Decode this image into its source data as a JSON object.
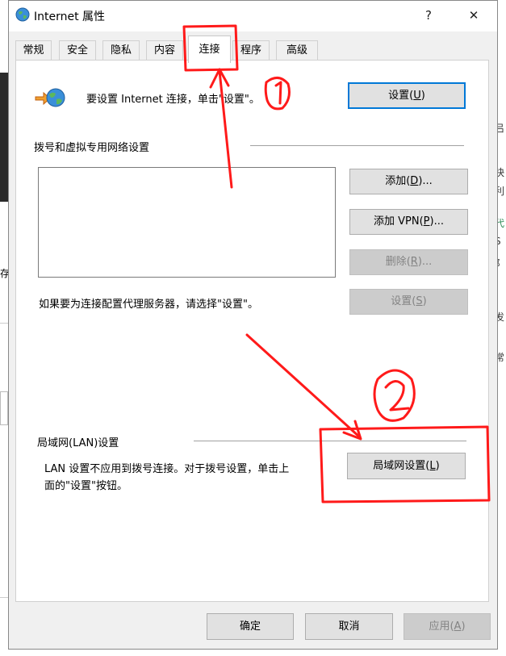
{
  "window": {
    "title": "Internet 属性",
    "help_glyph": "?",
    "close_glyph": "✕"
  },
  "tabs": [
    {
      "label": "常规"
    },
    {
      "label": "安全"
    },
    {
      "label": "隐私"
    },
    {
      "label": "内容"
    },
    {
      "label": "连接",
      "active": true
    },
    {
      "label": "程序"
    },
    {
      "label": "高级"
    }
  ],
  "setup": {
    "text": "要设置 Internet 连接，单击\"设置\"。",
    "button": {
      "pre": "设置(",
      "key": "U",
      "post": ")"
    }
  },
  "dialup": {
    "heading": "拨号和虚拟专用网络设置",
    "add": {
      "pre": "添加(",
      "key": "D",
      "post": ")..."
    },
    "add_vpn": {
      "pre": "添加 VPN(",
      "key": "P",
      "post": ")..."
    },
    "remove": {
      "pre": "删除(",
      "key": "R",
      "post": ")..."
    },
    "settings": {
      "pre": "设置(",
      "key": "S",
      "post": ")"
    },
    "proxy_note": "如果要为连接配置代理服务器，请选择\"设置\"。"
  },
  "lan": {
    "heading": "局域网(LAN)设置",
    "note_line1": "LAN 设置不应用到拨号连接。对于拨号设置，单击上",
    "note_line2": "面的\"设置\"按钮。",
    "button": {
      "pre": "局域网设置(",
      "key": "L",
      "post": ")"
    }
  },
  "footer": {
    "ok": "确定",
    "cancel": "取消",
    "apply": {
      "pre": "应用(",
      "key": "A",
      "post": ")"
    }
  },
  "annotations": {
    "circle_1": "1",
    "circle_2": "2",
    "color": "#ff1a1a"
  },
  "background_fragments": [
    "存",
    "吕",
    "快",
    "利",
    "代",
    "S",
    "阝",
    "发",
    "i",
    "常"
  ]
}
